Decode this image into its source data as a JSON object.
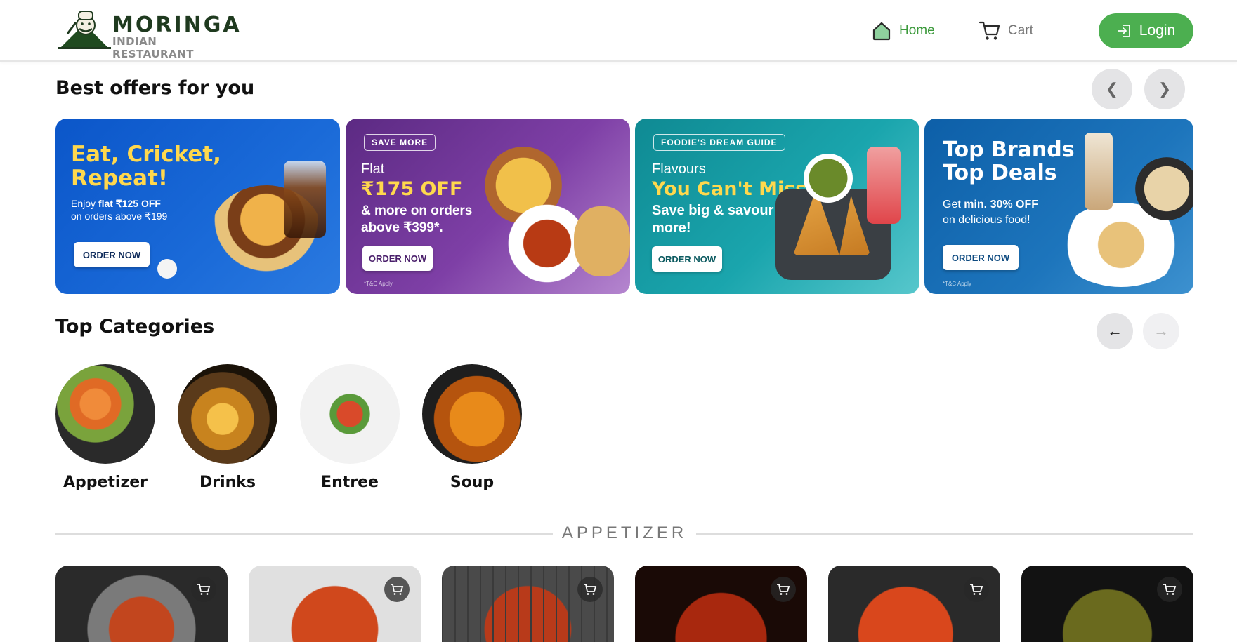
{
  "header": {
    "logo_title": "MORINGA",
    "logo_subtitle": "INDIAN RESTAURANT",
    "nav": [
      {
        "label": "Home",
        "icon": "home-icon",
        "active": true
      },
      {
        "label": "Cart",
        "icon": "cart-icon",
        "active": false
      }
    ],
    "login_label": "Login"
  },
  "offers": {
    "title": "Best offers for you",
    "prev_symbol": "❮",
    "next_symbol": "❯",
    "banners": [
      {
        "headline": "Eat, Cricket, Repeat!",
        "line1_pre": "Enjoy ",
        "line1_bold": "flat ₹125 OFF",
        "line2": "on orders above ₹199",
        "button": "ORDER NOW"
      },
      {
        "tag": "SAVE MORE",
        "pre": "Flat",
        "headline": "₹175 OFF",
        "sub": "& more on orders above ₹399*.",
        "button": "ORDER NOW",
        "tc": "*T&C Apply"
      },
      {
        "tag": "FOODIE'S DREAM GUIDE",
        "pre": "Flavours",
        "headline": "You Can't Miss",
        "sub": "Save big & savour more!",
        "button": "ORDER NOW"
      },
      {
        "headline": "Top Brands Top Deals",
        "line1_pre": "Get ",
        "line1_bold": "min. 30% OFF",
        "line2": "on delicious food!",
        "button": "ORDER NOW",
        "tc": "*T&C Apply"
      }
    ]
  },
  "categories": {
    "title": "Top Categories",
    "prev_symbol": "←",
    "next_symbol": "→",
    "items": [
      {
        "label": "Appetizer"
      },
      {
        "label": "Drinks"
      },
      {
        "label": "Entree"
      },
      {
        "label": "Soup"
      }
    ]
  },
  "section": {
    "heading": "APPETIZER"
  },
  "colors": {
    "accent": "#4caf50",
    "nav_active": "#3c9a3c"
  }
}
